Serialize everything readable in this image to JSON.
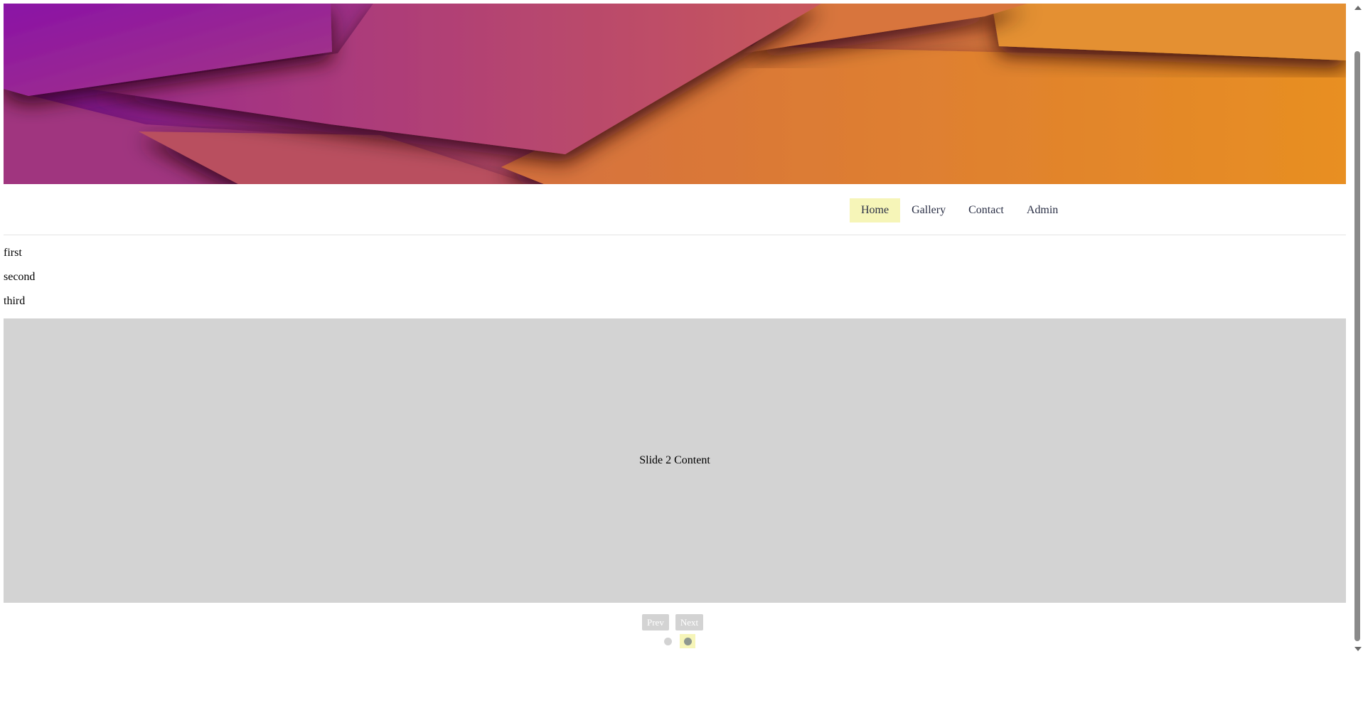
{
  "colors": {
    "nav_active_bg": "#f6f5b8",
    "slide_bg": "#d3d3d3",
    "dot_inactive": "#d3d3d3",
    "dot_active": "#8f9890",
    "hero_gradient_start": "#7e0aa8",
    "hero_gradient_end": "#f7ae0b"
  },
  "nav": {
    "items": [
      {
        "label": "Home",
        "active": true
      },
      {
        "label": "Gallery",
        "active": false
      },
      {
        "label": "Contact",
        "active": false
      },
      {
        "label": "Admin",
        "active": false
      }
    ]
  },
  "list": {
    "items": [
      "first",
      "second",
      "third"
    ]
  },
  "slider": {
    "content": "Slide 2 Content",
    "prev_label": "Prev",
    "next_label": "Next",
    "dots_count": 2,
    "active_dot": 2
  },
  "icons": {
    "scroll_up": "scroll-up-arrow-icon",
    "scroll_down": "scroll-down-arrow-icon"
  }
}
